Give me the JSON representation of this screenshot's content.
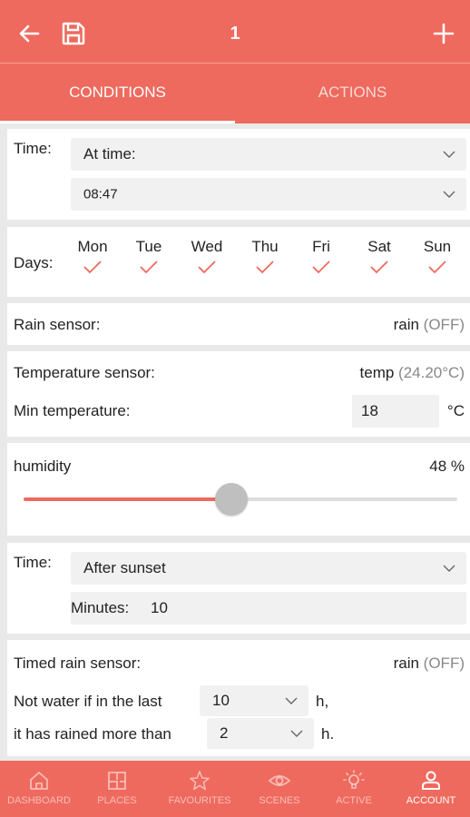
{
  "header": {
    "title": "1"
  },
  "tabs": [
    {
      "label": "CONDITIONS",
      "active": true
    },
    {
      "label": "ACTIONS",
      "active": false
    }
  ],
  "time_condition": {
    "label": "Time:",
    "mode": "At time:",
    "time": "08:47"
  },
  "days": {
    "label": "Days:",
    "items": [
      {
        "name": "Mon",
        "checked": true
      },
      {
        "name": "Tue",
        "checked": true
      },
      {
        "name": "Wed",
        "checked": true
      },
      {
        "name": "Thu",
        "checked": true
      },
      {
        "name": "Fri",
        "checked": true
      },
      {
        "name": "Sat",
        "checked": true
      },
      {
        "name": "Sun",
        "checked": true
      }
    ]
  },
  "rain_sensor": {
    "label": "Rain sensor:",
    "name": "rain",
    "state": "(OFF)"
  },
  "temperature": {
    "label": "Temperature sensor:",
    "name": "temp",
    "reading": "(24.20°C)",
    "min_label": "Min temperature:",
    "min_value": "18",
    "unit": "°C"
  },
  "humidity": {
    "label": "humidity",
    "value_text": "48 %",
    "value": 48
  },
  "sunset": {
    "label": "Time:",
    "mode": "After sunset",
    "minutes_label": "Minutes:",
    "minutes_value": "10"
  },
  "timed_rain": {
    "label": "Timed rain sensor:",
    "name": "rain",
    "state": "(OFF)",
    "line1_label": "Not water if in the last",
    "line1_value": "10",
    "line1_unit": "h,",
    "line2_label": "it has rained more than",
    "line2_value": "2",
    "line2_unit": "h."
  },
  "bottom_nav": [
    {
      "label": "DASHBOARD",
      "icon": "home-icon",
      "active": false
    },
    {
      "label": "PLACES",
      "icon": "floorplan-icon",
      "active": false
    },
    {
      "label": "FAVOURITES",
      "icon": "star-icon",
      "active": false
    },
    {
      "label": "SCENES",
      "icon": "eye-icon",
      "active": false
    },
    {
      "label": "ACTIVE",
      "icon": "bulb-icon",
      "active": false
    },
    {
      "label": "ACCOUNT",
      "icon": "user-icon",
      "active": true
    }
  ],
  "colors": {
    "accent": "#ee6a5e",
    "field": "#f1f1f1",
    "background": "#e9e9e9"
  }
}
